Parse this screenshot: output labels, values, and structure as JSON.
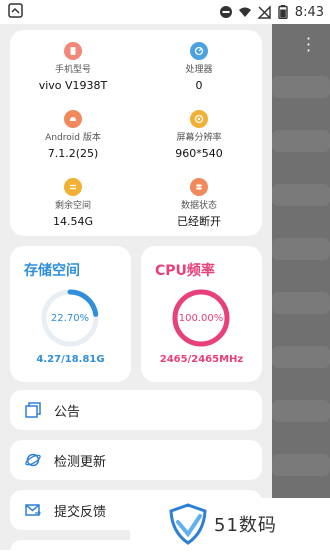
{
  "statusbar": {
    "time": "8:43",
    "battery_level": 0.7
  },
  "device_info": {
    "items": [
      {
        "label": "手机型号",
        "value": "vivo V1938T",
        "icon": "phone-icon",
        "color": "#f2877a"
      },
      {
        "label": "处理器",
        "value": "0",
        "icon": "cpu-gauge-icon",
        "color": "#4aa3e0"
      },
      {
        "label": "Android 版本",
        "value": "7.1.2(25)",
        "icon": "android-icon",
        "color": "#f08a5d"
      },
      {
        "label": "屏幕分辨率",
        "value": "960*540",
        "icon": "screen-icon",
        "color": "#f2b134"
      },
      {
        "label": "剩余空间",
        "value": "14.54G",
        "icon": "storage-icon",
        "color": "#f2b134"
      },
      {
        "label": "数据状态",
        "value": "已经断开",
        "icon": "data-icon",
        "color": "#f08a5d"
      }
    ]
  },
  "storage": {
    "title": "存储空间",
    "percent_text": "22.70%",
    "percent": 22.7,
    "usage": "4.27/18.81G",
    "color": "#2f8fdc"
  },
  "cpu": {
    "title": "CPU频率",
    "percent_text": "100.00%",
    "percent": 100,
    "usage": "2465/2465MHz",
    "color": "#e8407a"
  },
  "menu": {
    "items": [
      {
        "label": "公告",
        "icon": "announcement-icon"
      },
      {
        "label": "检测更新",
        "icon": "update-icon"
      },
      {
        "label": "提交反馈",
        "icon": "feedback-icon"
      }
    ]
  },
  "watermark": {
    "text": "51数码"
  }
}
